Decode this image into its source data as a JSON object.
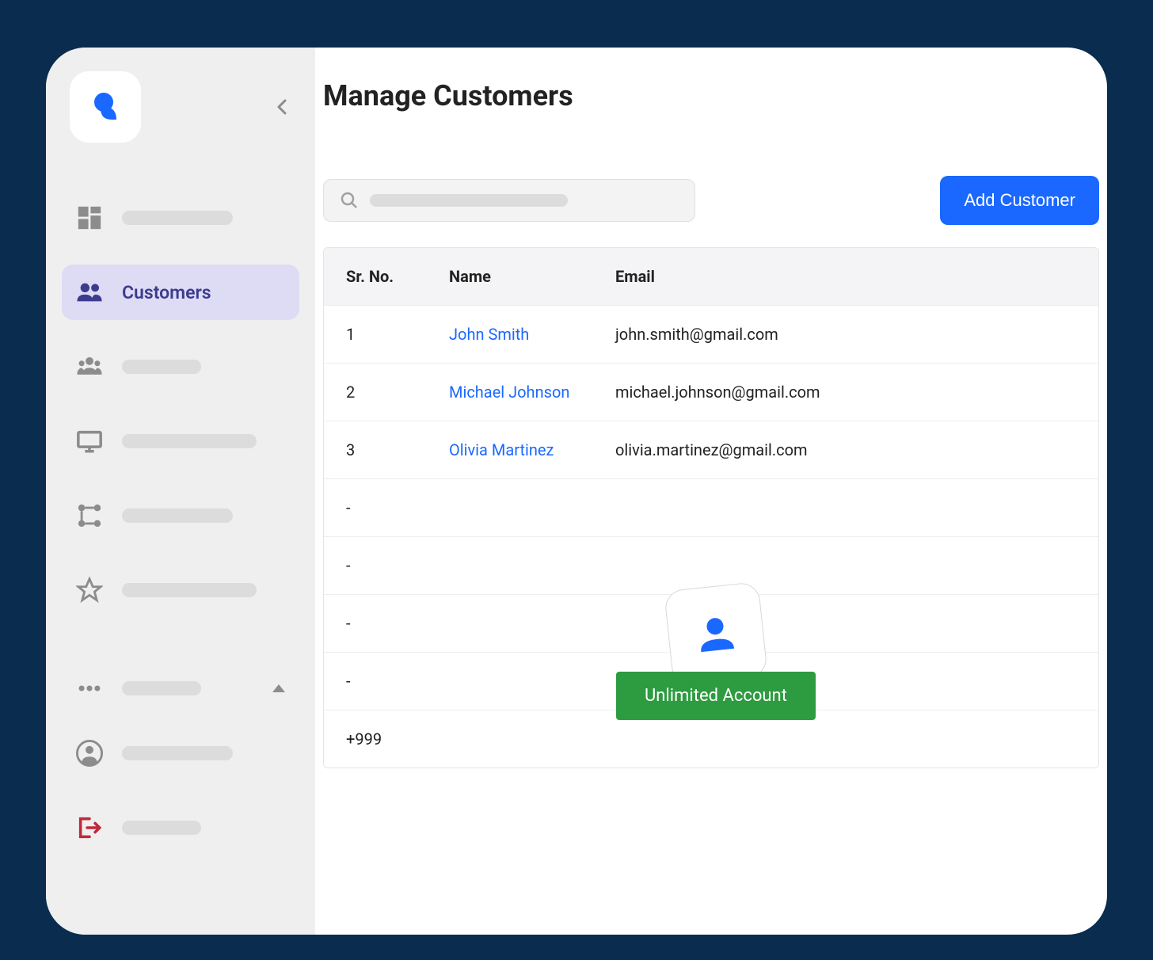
{
  "sidebar": {
    "items": [
      {
        "icon": "dashboard"
      },
      {
        "icon": "customers",
        "label": "Customers",
        "active": true
      },
      {
        "icon": "group"
      },
      {
        "icon": "screen"
      },
      {
        "icon": "nodes"
      },
      {
        "icon": "star"
      }
    ],
    "more_icon": "dots",
    "profile_icon": "account",
    "logout_icon": "logout"
  },
  "page": {
    "title": "Manage Customers"
  },
  "toolbar": {
    "add_button": "Add Customer"
  },
  "table": {
    "headers": {
      "sr": "Sr. No.",
      "name": "Name",
      "email": "Email"
    },
    "rows": [
      {
        "sr": "1",
        "name": "John Smith",
        "email": "john.smith@gmail.com"
      },
      {
        "sr": "2",
        "name": "Michael Johnson",
        "email": "michael.johnson@gmail.com"
      },
      {
        "sr": "3",
        "name": "Olivia Martinez",
        "email": "olivia.martinez@gmail.com"
      }
    ],
    "placeholder_sr": "-",
    "more_count": "+999"
  },
  "overlay": {
    "badge": "Unlimited Account"
  }
}
